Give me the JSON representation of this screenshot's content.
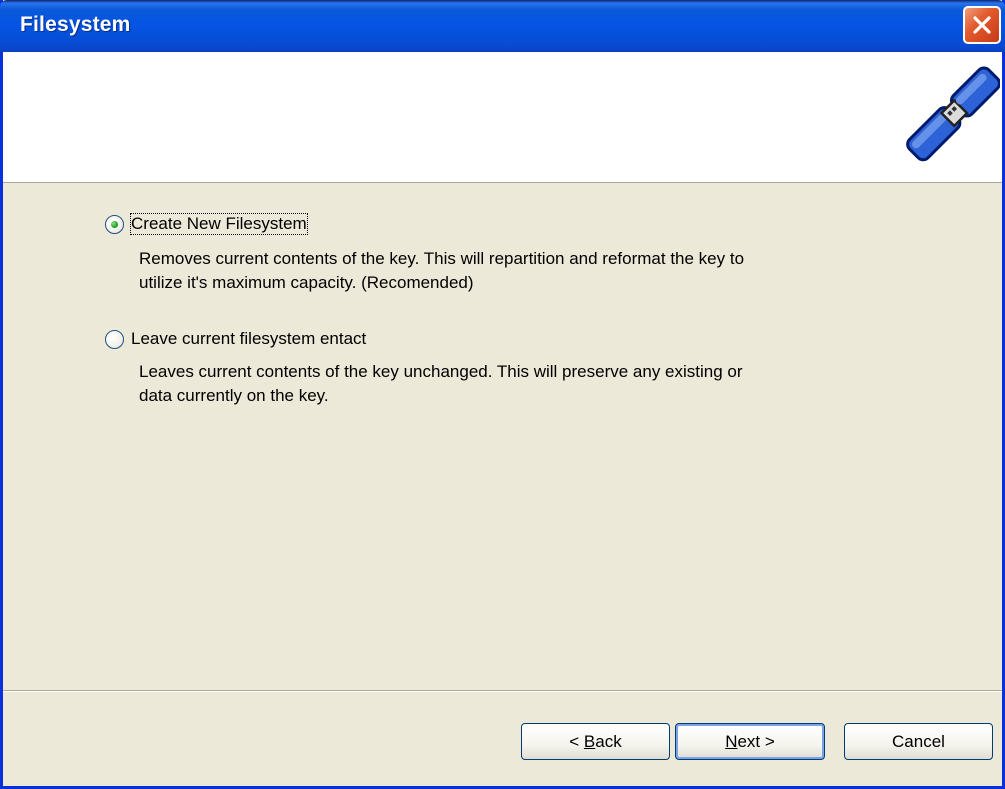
{
  "window": {
    "title": "Filesystem"
  },
  "options": [
    {
      "label": "Create New Filesystem",
      "selected": true,
      "description_line1": "Removes current contents of the key.  This will repartition and reformat the key to",
      "description_line2": "utilize it's maximum capacity.  (Recomended)"
    },
    {
      "label": "Leave current filesystem entact",
      "selected": false,
      "description_line1": "Leaves current contents of the key unchanged.  This will preserve any existing or",
      "description_line2": "data currently on the key."
    }
  ],
  "buttons": {
    "back_prefix": "< ",
    "back_mnemonic": "B",
    "back_rest": "ack",
    "next_mnemonic": "N",
    "next_rest": "ext >",
    "cancel": "Cancel"
  },
  "colors": {
    "titlebar": "#0554e3",
    "dialog_bg": "#ece9d8",
    "header_bg": "#ffffff",
    "close_button": "#e35a2d"
  },
  "icons": {
    "header": "usb-key-icon",
    "close": "close-icon"
  }
}
